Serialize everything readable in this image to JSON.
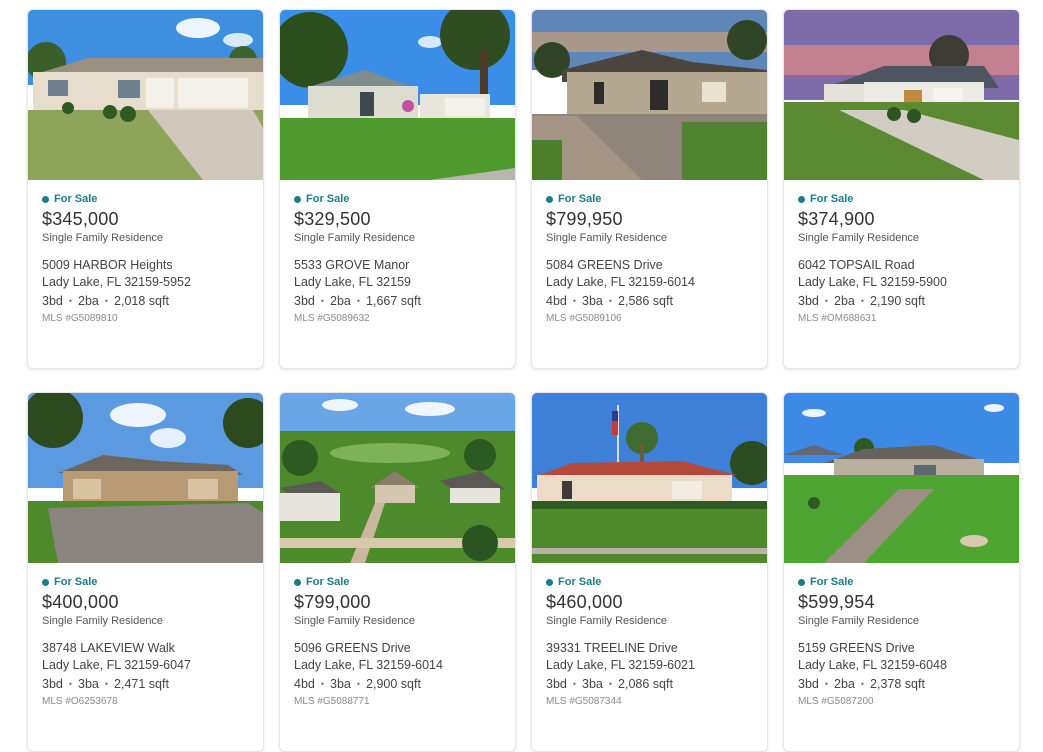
{
  "listings": [
    {
      "status": "For Sale",
      "price": "$345,000",
      "type": "Single Family Residence",
      "street": "5009 HARBOR Heights",
      "city": "Lady Lake, FL 32159-5952",
      "beds": "3bd",
      "baths": "2ba",
      "sqft": "2,018 sqft",
      "mls": "MLS #G5089810"
    },
    {
      "status": "For Sale",
      "price": "$329,500",
      "type": "Single Family Residence",
      "street": "5533 GROVE Manor",
      "city": "Lady Lake, FL 32159",
      "beds": "3bd",
      "baths": "2ba",
      "sqft": "1,667 sqft",
      "mls": "MLS #G5089632"
    },
    {
      "status": "For Sale",
      "price": "$799,950",
      "type": "Single Family Residence",
      "street": "5084 GREENS Drive",
      "city": "Lady Lake, FL 32159-6014",
      "beds": "4bd",
      "baths": "3ba",
      "sqft": "2,586 sqft",
      "mls": "MLS #G5089106"
    },
    {
      "status": "For Sale",
      "price": "$374,900",
      "type": "Single Family Residence",
      "street": "6042 TOPSAIL Road",
      "city": "Lady Lake, FL 32159-5900",
      "beds": "3bd",
      "baths": "2ba",
      "sqft": "2,190 sqft",
      "mls": "MLS #OM688631"
    },
    {
      "status": "For Sale",
      "price": "$400,000",
      "type": "Single Family Residence",
      "street": "38748 LAKEVIEW Walk",
      "city": "Lady Lake, FL 32159-6047",
      "beds": "3bd",
      "baths": "3ba",
      "sqft": "2,471 sqft",
      "mls": "MLS #O6253678"
    },
    {
      "status": "For Sale",
      "price": "$799,000",
      "type": "Single Family Residence",
      "street": "5096 GREENS Drive",
      "city": "Lady Lake, FL 32159-6014",
      "beds": "4bd",
      "baths": "3ba",
      "sqft": "2,900 sqft",
      "mls": "MLS #G5088771"
    },
    {
      "status": "For Sale",
      "price": "$460,000",
      "type": "Single Family Residence",
      "street": "39331 TREELINE Drive",
      "city": "Lady Lake, FL 32159-6021",
      "beds": "3bd",
      "baths": "3ba",
      "sqft": "2,086 sqft",
      "mls": "MLS #G5087344"
    },
    {
      "status": "For Sale",
      "price": "$599,954",
      "type": "Single Family Residence",
      "street": "5159 GREENS Drive",
      "city": "Lady Lake, FL 32159-6048",
      "beds": "3bd",
      "baths": "2ba",
      "sqft": "2,378 sqft",
      "mls": "MLS #G5087200"
    }
  ],
  "separator": "•",
  "colors": {
    "status": "#1d7c8a"
  }
}
